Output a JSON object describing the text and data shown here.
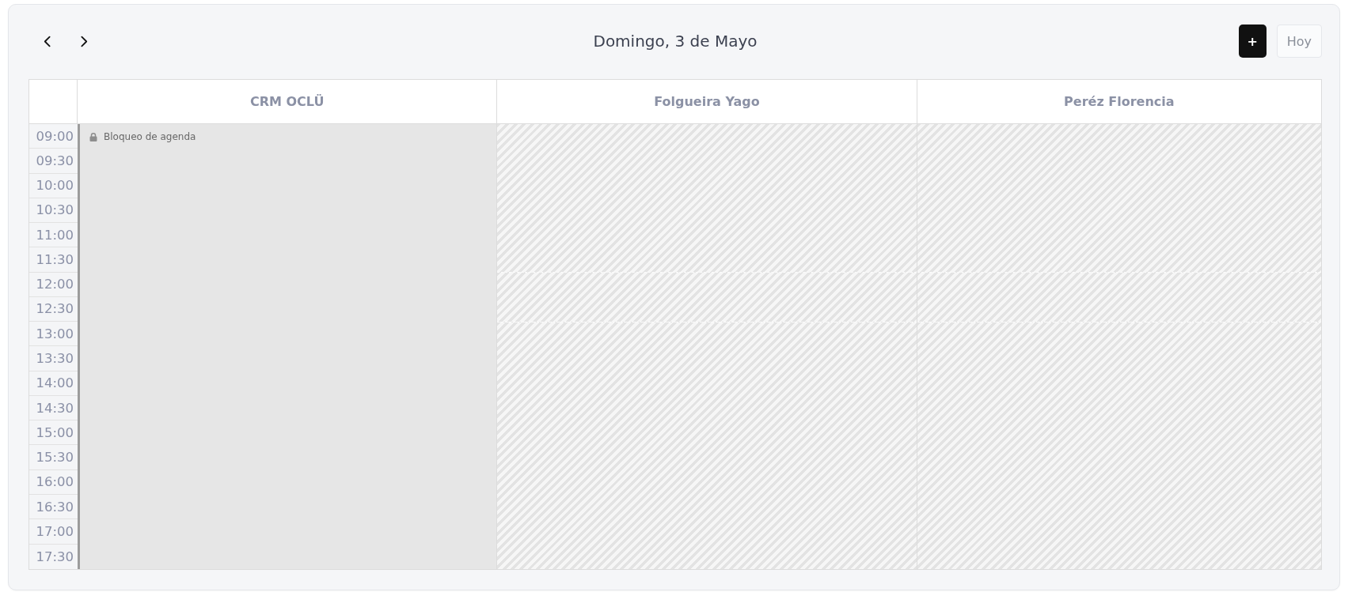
{
  "header": {
    "title": "Domingo, 3 de Mayo",
    "add_button": "+",
    "today_button": "Hoy"
  },
  "time_slots": [
    {
      "label": "09:00",
      "boundary": false
    },
    {
      "label": "09:30",
      "boundary": false
    },
    {
      "label": "10:00",
      "boundary": false
    },
    {
      "label": "10:30",
      "boundary": false
    },
    {
      "label": "11:00",
      "boundary": false
    },
    {
      "label": "11:30",
      "boundary": false
    },
    {
      "label": "12:00",
      "boundary": true
    },
    {
      "label": "12:30",
      "boundary": false
    },
    {
      "label": "13:00",
      "boundary": true
    },
    {
      "label": "13:30",
      "boundary": false
    },
    {
      "label": "14:00",
      "boundary": false
    },
    {
      "label": "14:30",
      "boundary": false
    },
    {
      "label": "15:00",
      "boundary": false
    },
    {
      "label": "15:30",
      "boundary": false
    },
    {
      "label": "16:00",
      "boundary": false
    },
    {
      "label": "16:30",
      "boundary": false
    },
    {
      "label": "17:00",
      "boundary": false
    },
    {
      "label": "17:30",
      "boundary": false
    }
  ],
  "columns": [
    {
      "name": "CRM OCLÜ",
      "kind": "schedule",
      "events": [
        {
          "title": "Bloqueo de agenda",
          "kind": "block"
        }
      ]
    },
    {
      "name": "Folgueira Yago",
      "kind": "unavailable"
    },
    {
      "name": "Peréz Florencia",
      "kind": "unavailable"
    }
  ]
}
